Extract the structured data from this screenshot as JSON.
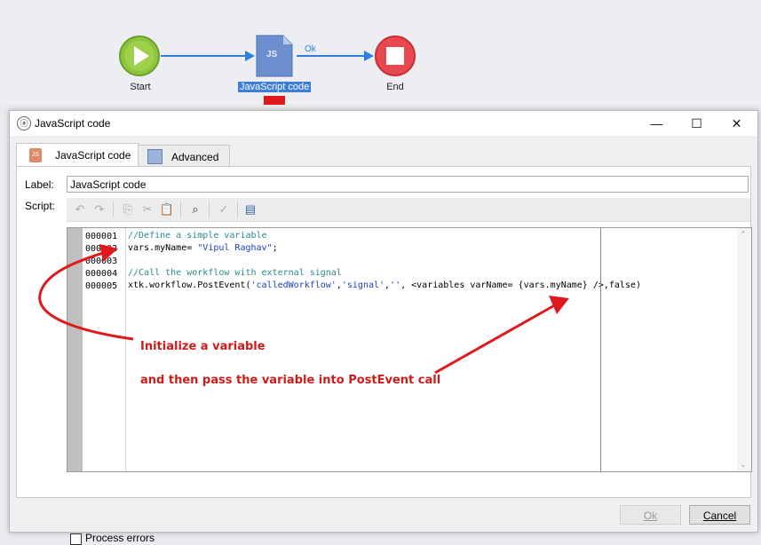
{
  "workflow": {
    "start_label": "Start",
    "js_label": "JavaScript code",
    "js_icon_text": "JS",
    "transition_label": "Ok",
    "end_label": "End"
  },
  "dialog": {
    "title": "JavaScript code",
    "tabs": [
      {
        "label": "JavaScript code",
        "icon_text": "JS"
      },
      {
        "label": "Advanced"
      }
    ],
    "label_field": {
      "label": "Label:",
      "value": "JavaScript code"
    },
    "script_label": "Script:",
    "line_numbers": [
      "000001",
      "000002",
      "000003",
      "000004",
      "000005"
    ],
    "code": {
      "line1_comment": "//Define a simple variable",
      "line2_pre": "vars.myName= ",
      "line2_str": "\"Vipul Raghav\"",
      "line2_post": ";",
      "line4_comment": "//Call the workflow with external signal",
      "line5_a": "xtk.workflow.PostEvent(",
      "line5_s1": "'calledWorkflow'",
      "line5_b": ",",
      "line5_s2": "'signal'",
      "line5_c": ",",
      "line5_s3": "''",
      "line5_d": ", <variables varName= {vars.myName} />,false)"
    },
    "process_errors_label": "Process errors",
    "process_errors_checked": false,
    "ok_button": "Ok",
    "cancel_button": "Cancel"
  },
  "annotations": {
    "line1": "Initialize a variable",
    "line2": "and then pass the variable into PostEvent call"
  },
  "colors": {
    "start": "#8cc63f",
    "js": "#6d8fcf",
    "end": "#e8484f",
    "arrow_blue": "#2e7fe0",
    "annot_red": "#e0191f"
  }
}
